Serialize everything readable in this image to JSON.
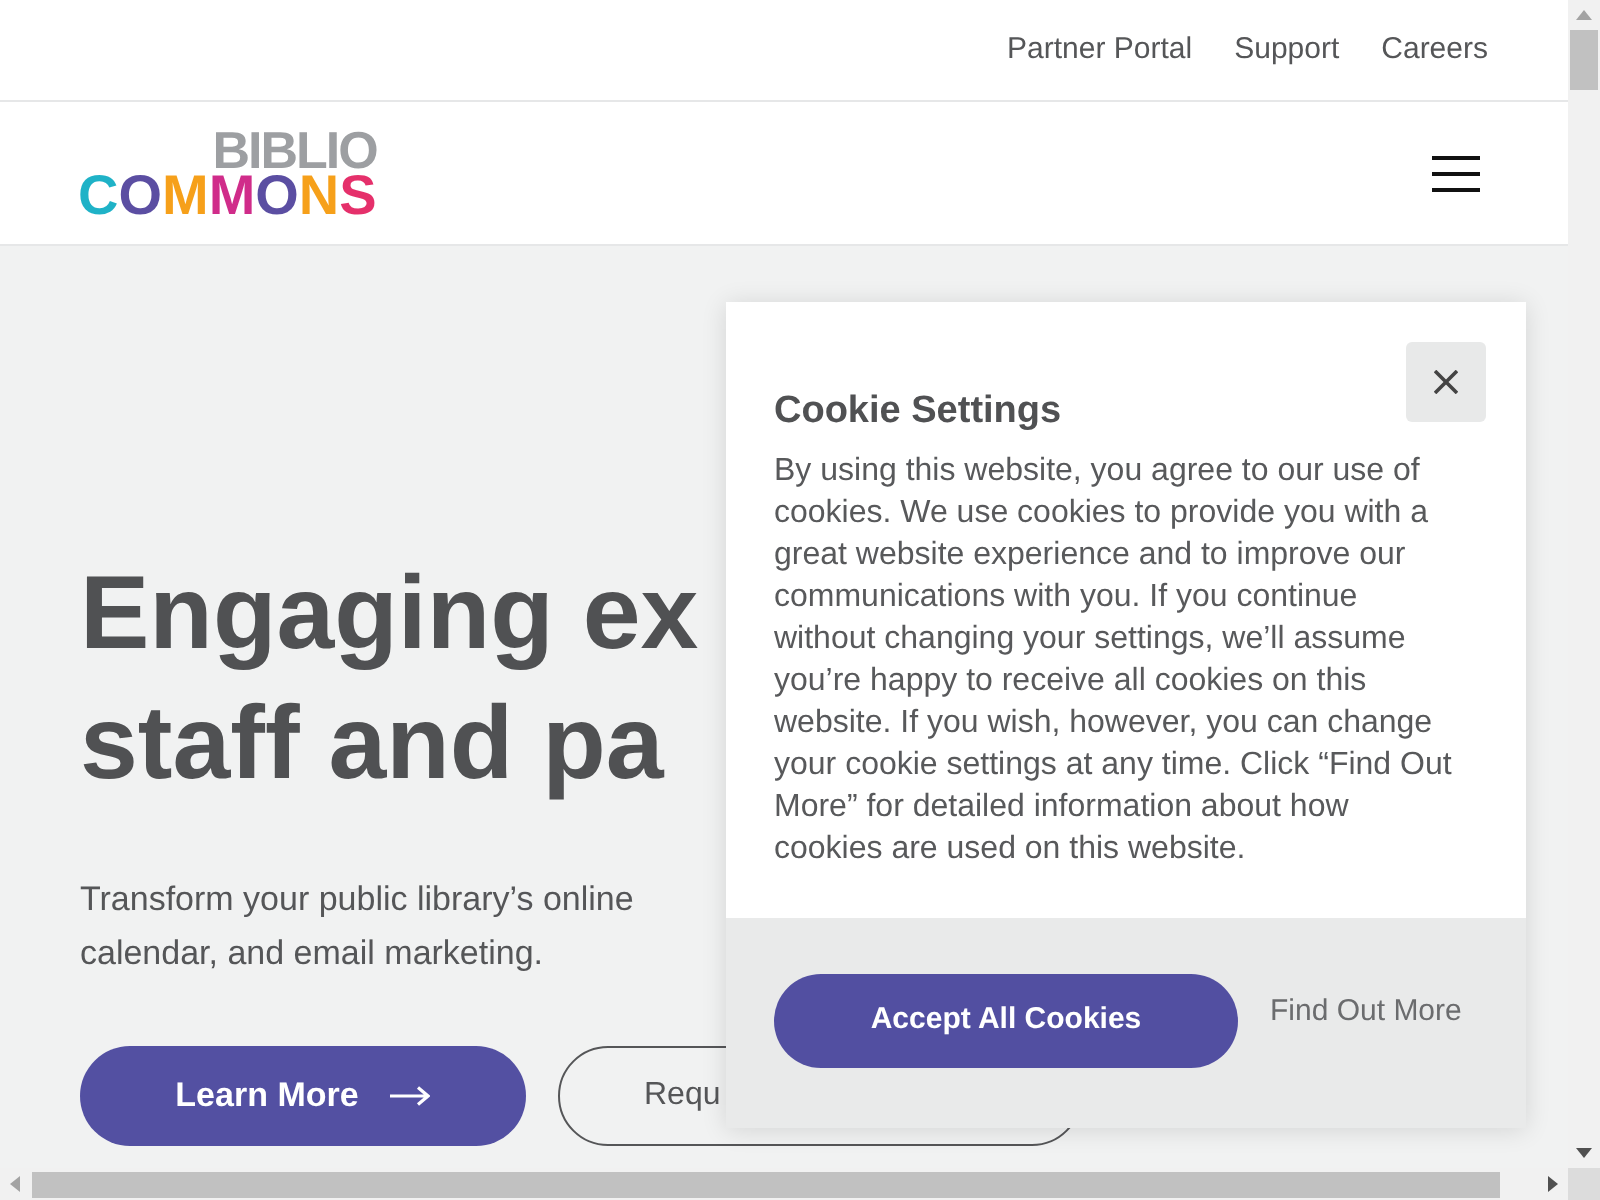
{
  "top_links": [
    {
      "label": "Partner Portal"
    },
    {
      "label": "Support"
    },
    {
      "label": "Careers"
    }
  ],
  "logo": {
    "top": "BIBLIO",
    "bottom": "COMMONS"
  },
  "hero": {
    "headline_lines": [
      "Engaging ex",
      "staff and pa"
    ],
    "description_lines": [
      "Transform your public library’s online",
      "calendar, and email marketing."
    ],
    "buttons": [
      {
        "label": "Learn More",
        "kind": "primary"
      },
      {
        "label": "Requ",
        "kind": "outline"
      }
    ]
  },
  "cookie_dialog": {
    "title": "Cookie Settings",
    "body": "By using this website, you agree to our use of cookies. We use cookies to provide you with a great website experience and to improve our communications with you. If you continue without changing your settings, we’ll assume you’re happy to receive all cookies on this website. If you wish, however, you can change your cookie settings at any time. Click “Find Out More” for detailed information about how cookies are used on this website.",
    "buttons": [
      {
        "label": "Accept All Cookies",
        "kind": "primary"
      },
      {
        "label": "Find Out More",
        "kind": "link"
      }
    ]
  }
}
